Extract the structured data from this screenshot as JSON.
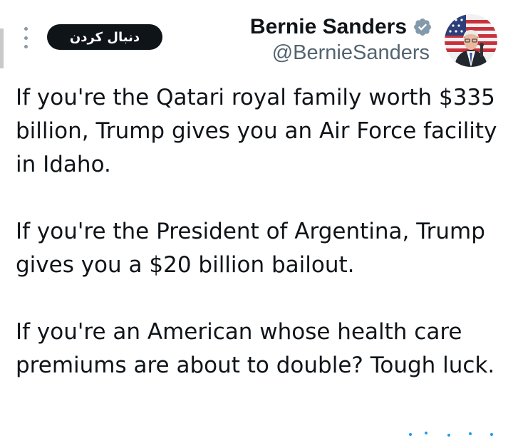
{
  "header": {
    "follow_label": "دنبال کردن",
    "name": "Bernie Sanders",
    "handle": "@BernieSanders",
    "verified_icon": "verified-badge-icon",
    "more_icon": "more-options-icon"
  },
  "tweet": {
    "paragraphs": [
      "If you're the Qatari royal family worth $335 billion, Trump gives you an Air Force facility in Idaho.",
      "If you're the President of Argentina, Trump gives you a $20 billion bailout.",
      "If you're an American whose health care premiums are about to double? Tough luck."
    ]
  },
  "colors": {
    "text": "#0f1419",
    "secondary": "#536471",
    "button_bg": "#0f1419",
    "badge": "#829aab",
    "accent": "#1d9bf0"
  }
}
